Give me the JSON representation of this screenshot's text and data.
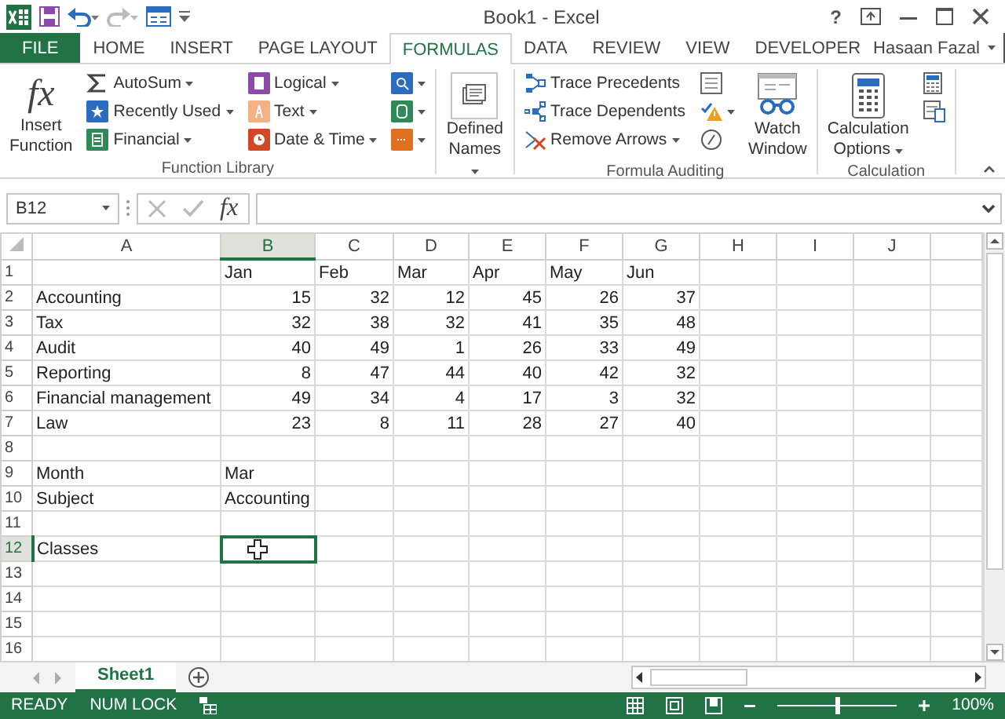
{
  "window": {
    "title": "Book1 - Excel",
    "help": "?"
  },
  "ribbon_tabs": [
    {
      "label": "FILE",
      "kind": "file",
      "selected": false
    },
    {
      "label": "HOME",
      "kind": "tab",
      "selected": false
    },
    {
      "label": "INSERT",
      "kind": "tab",
      "selected": false
    },
    {
      "label": "PAGE LAYOUT",
      "kind": "tab",
      "selected": false
    },
    {
      "label": "FORMULAS",
      "kind": "tab",
      "selected": true
    },
    {
      "label": "DATA",
      "kind": "tab",
      "selected": false
    },
    {
      "label": "REVIEW",
      "kind": "tab",
      "selected": false
    },
    {
      "label": "VIEW",
      "kind": "tab",
      "selected": false
    },
    {
      "label": "DEVELOPER",
      "kind": "tab",
      "selected": false
    }
  ],
  "user": {
    "name": "Hasaan Fazal"
  },
  "ribbon_groups": [
    {
      "label": "Function Library",
      "columns": [
        [
          {
            "kind": "large",
            "label": "Insert Function",
            "glyph": "fx",
            "dropdown": false
          }
        ],
        [
          {
            "kind": "small",
            "label": "AutoSum",
            "dropdown": true
          },
          {
            "kind": "small",
            "label": "Recently Used",
            "dropdown": true
          },
          {
            "kind": "small",
            "label": "Financial",
            "dropdown": true
          }
        ],
        [
          {
            "kind": "small",
            "label": "Logical",
            "dropdown": true
          },
          {
            "kind": "small",
            "label": "Text",
            "dropdown": true
          },
          {
            "kind": "small",
            "label": "Date & Time",
            "dropdown": true
          }
        ],
        [
          {
            "kind": "icon",
            "dropdown": true
          },
          {
            "kind": "icon",
            "dropdown": true
          },
          {
            "kind": "icon",
            "dropdown": true
          }
        ]
      ]
    },
    {
      "columns": [
        [
          {
            "kind": "large",
            "label": "Defined Names",
            "dropdown": true
          }
        ]
      ]
    },
    {
      "label": "Formula Auditing",
      "columns": [
        [
          {
            "kind": "small",
            "label": "Trace Precedents",
            "dropdown": false
          },
          {
            "kind": "small",
            "label": "Trace Dependents",
            "dropdown": false
          },
          {
            "kind": "small",
            "label": "Remove Arrows",
            "dropdown": true
          }
        ],
        [
          {
            "kind": "icon",
            "dropdown": false
          },
          {
            "kind": "icon",
            "dropdown": true
          },
          {
            "kind": "icon",
            "dropdown": false
          }
        ],
        [
          {
            "kind": "large",
            "label": "Watch Window",
            "dropdown": false
          }
        ]
      ]
    },
    {
      "label": "Calculation",
      "columns": [
        [
          {
            "kind": "large",
            "label": "Calculation Options",
            "dropdown": true
          }
        ],
        [
          {
            "kind": "icon",
            "dropdown": false
          },
          {
            "kind": "icon",
            "dropdown": false
          }
        ]
      ]
    }
  ],
  "formula_bar": {
    "name_box": "B12",
    "glyph": "fx"
  },
  "columns": [
    {
      "label": "A",
      "selected": false
    },
    {
      "label": "B",
      "selected": true
    },
    {
      "label": "C",
      "selected": false
    },
    {
      "label": "D",
      "selected": false
    },
    {
      "label": "E",
      "selected": false
    },
    {
      "label": "F",
      "selected": false
    },
    {
      "label": "G",
      "selected": false
    },
    {
      "label": "H",
      "selected": false
    },
    {
      "label": "I",
      "selected": false
    },
    {
      "label": "J",
      "selected": false
    }
  ],
  "rows": [
    {
      "label": "1",
      "kind": "text",
      "selected": false,
      "cells": [
        null,
        "Jan",
        "Feb",
        "Mar",
        "Apr",
        "May",
        "Jun"
      ]
    },
    {
      "label": "2",
      "kind": "data",
      "selected": false,
      "cells": [
        "Accounting",
        "15",
        "32",
        "12",
        "45",
        "26",
        "37"
      ]
    },
    {
      "label": "3",
      "kind": "data",
      "selected": false,
      "cells": [
        "Tax",
        "32",
        "38",
        "32",
        "41",
        "35",
        "48"
      ]
    },
    {
      "label": "4",
      "kind": "data",
      "selected": false,
      "cells": [
        "Audit",
        "40",
        "49",
        "1",
        "26",
        "33",
        "49"
      ]
    },
    {
      "label": "5",
      "kind": "data",
      "selected": false,
      "cells": [
        "Reporting",
        "8",
        "47",
        "44",
        "40",
        "42",
        "32"
      ]
    },
    {
      "label": "6",
      "kind": "data",
      "selected": false,
      "cells": [
        "Financial management",
        "49",
        "34",
        "4",
        "17",
        "3",
        "32"
      ]
    },
    {
      "label": "7",
      "kind": "data",
      "selected": false,
      "cells": [
        "Law",
        "23",
        "8",
        "11",
        "28",
        "27",
        "40"
      ]
    },
    {
      "label": "8",
      "kind": "text",
      "selected": false,
      "cells": []
    },
    {
      "label": "9",
      "kind": "text",
      "selected": false,
      "cells": [
        "Month",
        "Mar"
      ]
    },
    {
      "label": "10",
      "kind": "text",
      "selected": false,
      "cells": [
        "Subject",
        "Accounting"
      ]
    },
    {
      "label": "11",
      "kind": "text",
      "selected": false,
      "cells": []
    },
    {
      "label": "12",
      "kind": "text",
      "selected": true,
      "cells": [
        "Classes"
      ]
    },
    {
      "label": "13",
      "kind": "text",
      "selected": false,
      "cells": []
    },
    {
      "label": "14",
      "kind": "text",
      "selected": false,
      "cells": []
    },
    {
      "label": "15",
      "kind": "text",
      "selected": false,
      "cells": []
    },
    {
      "label": "16",
      "kind": "text",
      "selected": false,
      "cells": []
    }
  ],
  "sheets": [
    {
      "label": "Sheet1",
      "selected": true
    }
  ],
  "status_bar": {
    "mode": "READY",
    "num_lock": "NUM LOCK",
    "zoom": "100%",
    "zoom_slider": {
      "level": 0.5
    }
  }
}
